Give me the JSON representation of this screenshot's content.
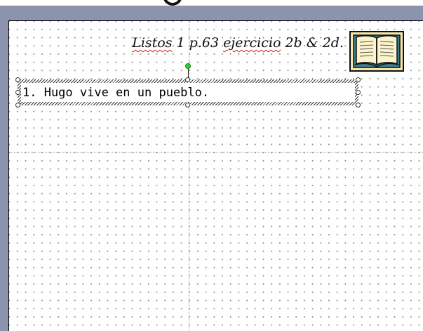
{
  "slide": {
    "title_prefix": "Listos",
    "title_middle": " 1 p.63 ",
    "title_ejercicio": "ejercicio",
    "title_suffix": " 2b & 2d."
  },
  "textbox": {
    "text": "1. Hugo vive en un pueblo."
  },
  "colors": {
    "frame": "#8c93ad",
    "rotate_handle": "#2bd42b",
    "spell_underline": "#d02020"
  },
  "icons": {
    "book": "open-book-icon"
  }
}
